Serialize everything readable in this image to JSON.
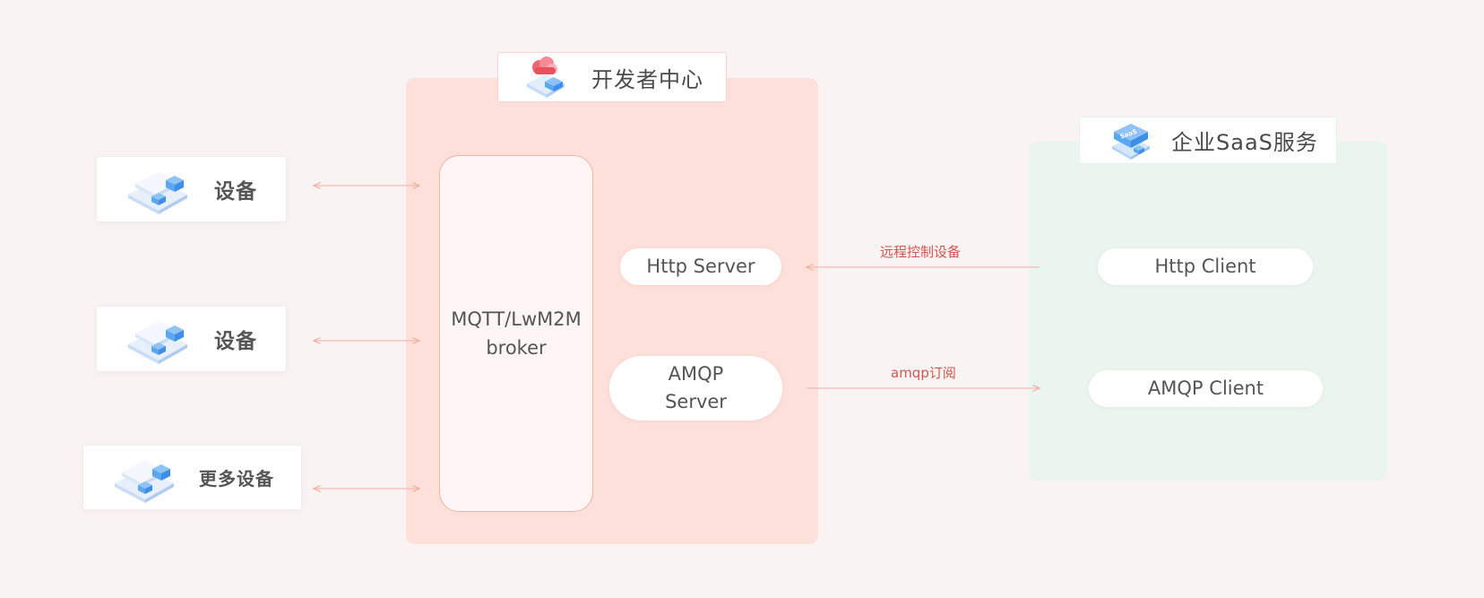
{
  "developer_center": {
    "title": "开发者中心",
    "broker": "MQTT/LwM2M\nbroker",
    "http_server": "Http Server",
    "amqp_server": "AMQP\nServer"
  },
  "enterprise_saas": {
    "title": "企业SaaS服务",
    "icon_text": "SaaS",
    "http_client": "Http Client",
    "amqp_client": "AMQP Client"
  },
  "devices": [
    {
      "label": "设备"
    },
    {
      "label": "设备"
    },
    {
      "label": "更多设备"
    }
  ],
  "edges": {
    "remote_control": "远程控制设备",
    "amqp_subscribe": "amqp订阅"
  },
  "colors": {
    "background": "#f9f3f3",
    "developer_panel": "#fde0da",
    "saas_panel": "#ebf5f0",
    "arrow": "#f5a9a0",
    "edge_label": "#d0564f",
    "device_icon_blue": "#5aa7f0"
  },
  "icons": {
    "developer_center": "cloud-device-icon",
    "saas": "saas-box-icon",
    "device": "iot-device-icon"
  }
}
